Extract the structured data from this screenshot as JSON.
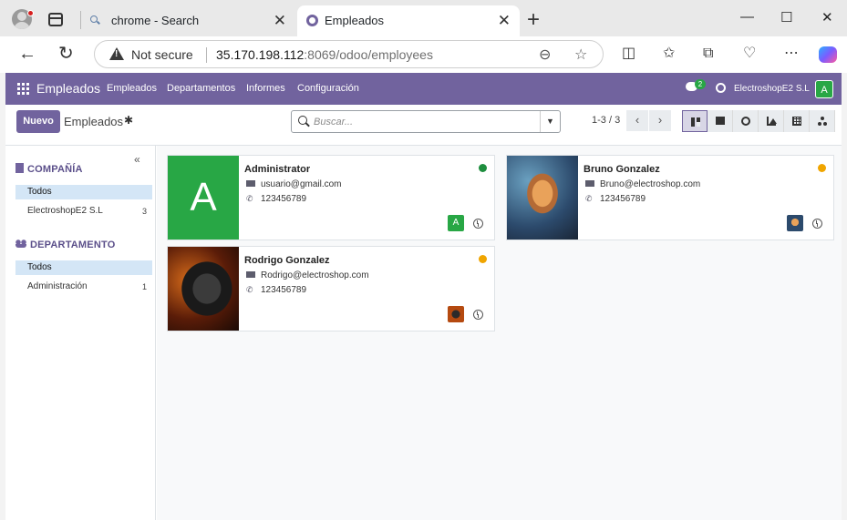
{
  "browser": {
    "tabs": [
      {
        "title": "chrome - Search",
        "active": false
      },
      {
        "title": "Empleados",
        "active": true
      }
    ],
    "address": {
      "security": "Not secure",
      "host": "35.170.198.112",
      "path": ":8069/odoo/employees"
    }
  },
  "navbar": {
    "app_name": "Empleados",
    "menus": [
      "Empleados",
      "Departamentos",
      "Informes",
      "Configuración"
    ],
    "chat_count": "2",
    "company": "ElectroshopE2 S.L",
    "user_initial": "A"
  },
  "control_panel": {
    "new_label": "Nuevo",
    "breadcrumb": "Empleados",
    "search_placeholder": "Buscar...",
    "pager": "1-3 / 3",
    "active_view": "kanban"
  },
  "sidebar": {
    "company": {
      "title": "COMPAÑÍA",
      "items": [
        {
          "label": "Todos",
          "active": true,
          "count": ""
        },
        {
          "label": "ElectroshopE2 S.L",
          "active": false,
          "count": "3"
        }
      ]
    },
    "department": {
      "title": "DEPARTAMENTO",
      "items": [
        {
          "label": "Todos",
          "active": true,
          "count": ""
        },
        {
          "label": "Administración",
          "active": false,
          "count": "1"
        }
      ]
    }
  },
  "employees": [
    {
      "name": "Administrator",
      "email": "usuario@gmail.com",
      "phone": "123456789",
      "status_color": "#1e8e3e",
      "avatar_letter": "A",
      "photo": "letter"
    },
    {
      "name": "Bruno Gonzalez",
      "email": "Bruno@electroshop.com",
      "phone": "123456789",
      "status_color": "#f0a500",
      "avatar_letter": "",
      "photo": "image"
    },
    {
      "name": "Rodrigo Gonzalez",
      "email": "Rodrigo@electroshop.com",
      "phone": "123456789",
      "status_color": "#f0a500",
      "avatar_letter": "",
      "photo": "image"
    }
  ],
  "colors": {
    "brand": "#71639e",
    "avatar_green": "#28a745"
  }
}
